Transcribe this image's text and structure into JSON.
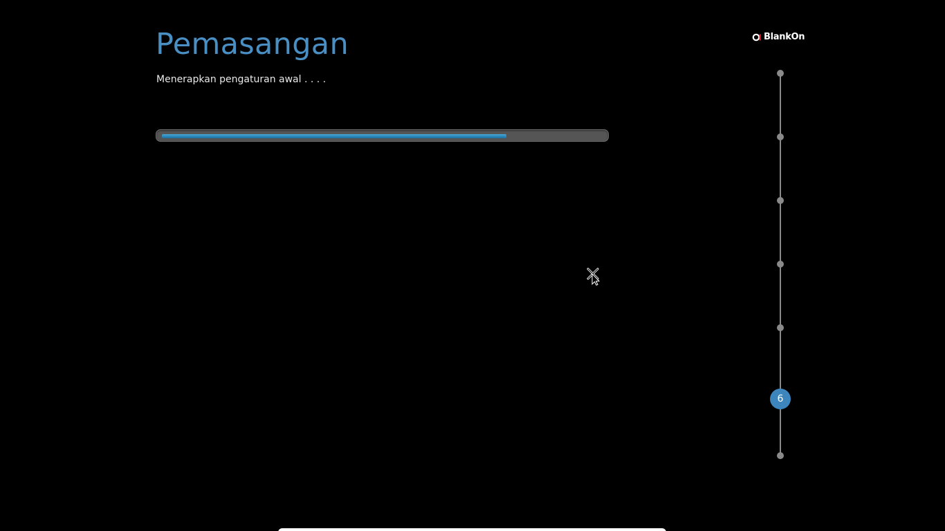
{
  "installer": {
    "title": "Pemasangan",
    "status": "Menerapkan pengaturan awal . . . .",
    "progress": 0.78
  },
  "brand": {
    "name": "BlankOn",
    "icon": "blankon-logo-icon"
  },
  "steps": {
    "total": 7,
    "current": 6,
    "current_label": "6"
  },
  "pointer": {
    "icon": "arrow-with-move-cross-cursor-icon"
  },
  "colors": {
    "background": "#000000",
    "title": "#4a8fc4",
    "accent": "#3d86bd",
    "progress_fill": "#2a86b8",
    "progress_track": "#555555",
    "step_line": "#8a8a8a"
  }
}
